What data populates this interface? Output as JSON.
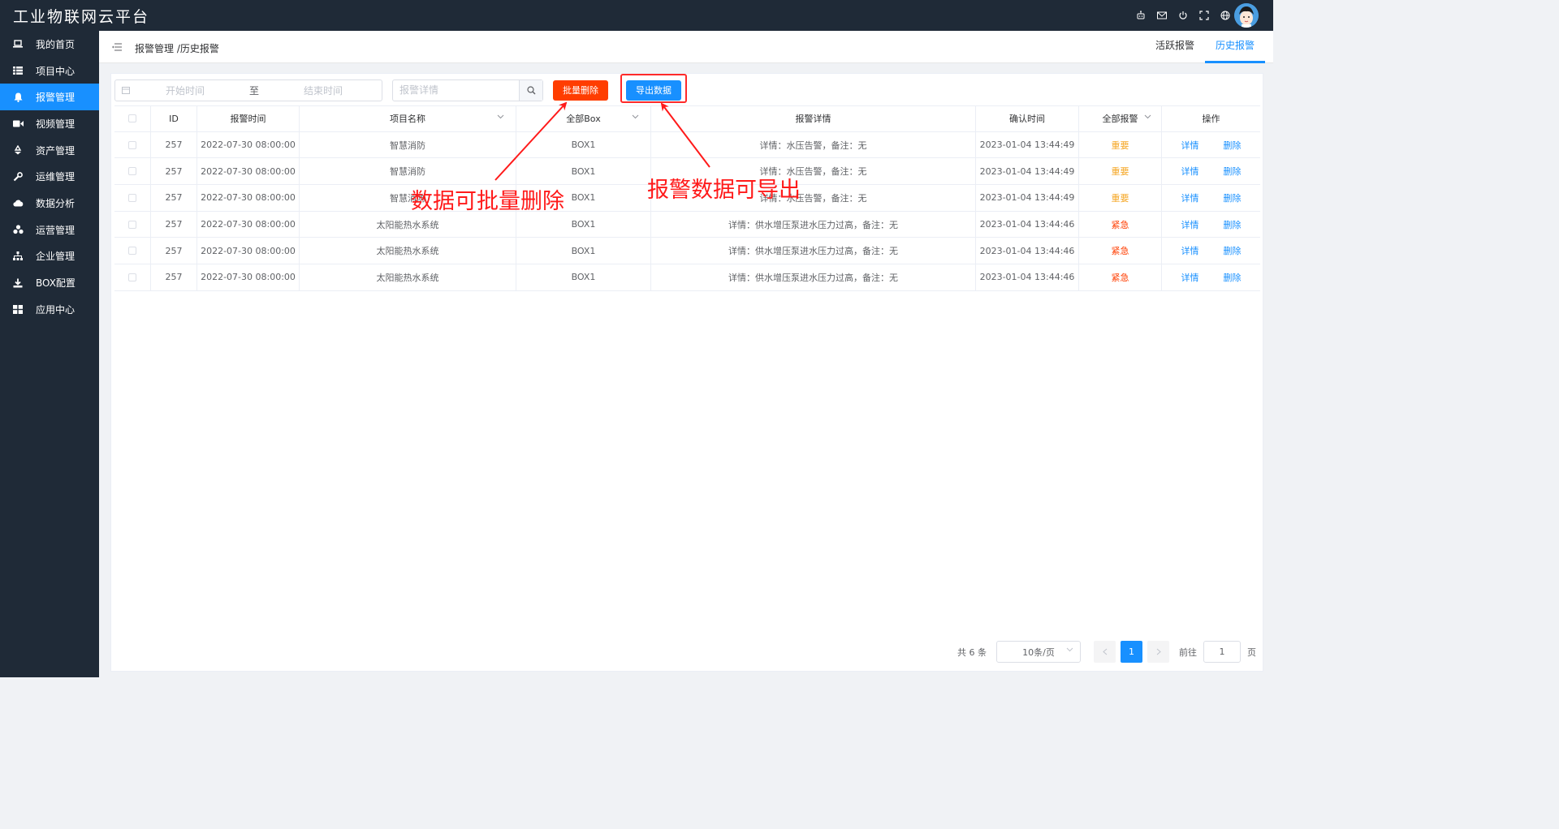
{
  "app": {
    "title": "工业物联网云平台"
  },
  "colors": {
    "sidebar_bg": "#1f2a37",
    "accent": "#1890ff",
    "danger": "#ff3d00",
    "warning": "#f5a623"
  },
  "topbar": {
    "icons": [
      "robot-icon",
      "mail-icon",
      "power-icon",
      "fullscreen-icon",
      "globe-icon"
    ]
  },
  "sidebar": {
    "items": [
      {
        "label": "我的首页",
        "icon": "laptop-icon",
        "active": false
      },
      {
        "label": "项目中心",
        "icon": "list-icon",
        "active": false
      },
      {
        "label": "报警管理",
        "icon": "bell-icon",
        "active": true
      },
      {
        "label": "视频管理",
        "icon": "video-icon",
        "active": false
      },
      {
        "label": "资产管理",
        "icon": "recycle-icon",
        "active": false
      },
      {
        "label": "运维管理",
        "icon": "wrench-icon",
        "active": false
      },
      {
        "label": "数据分析",
        "icon": "cloud-icon",
        "active": false
      },
      {
        "label": "运营管理",
        "icon": "cubes-icon",
        "active": false
      },
      {
        "label": "企业管理",
        "icon": "sitemap-icon",
        "active": false
      },
      {
        "label": "BOX配置",
        "icon": "download-icon",
        "active": false
      },
      {
        "label": "应用中心",
        "icon": "grid-icon",
        "active": false
      }
    ]
  },
  "header": {
    "breadcrumb": "报警管理 /历史报警",
    "tabs": [
      {
        "label": "活跃报警",
        "active": false
      },
      {
        "label": "历史报警",
        "active": true
      }
    ]
  },
  "filter": {
    "start_placeholder": "开始时间",
    "range_sep": "至",
    "end_placeholder": "结束时间",
    "search_placeholder": "报警详情",
    "batch_delete_label": "批量删除",
    "export_label": "导出数据"
  },
  "table": {
    "headers": {
      "id": "ID",
      "alarm_time": "报警时间",
      "project": "项目名称",
      "box": "全部Box",
      "detail": "报警详情",
      "confirm_time": "确认时间",
      "level": "全部报警",
      "ops": "操作"
    },
    "rows": [
      {
        "id": "257",
        "alarm_time": "2022-07-30 08:00:00",
        "project": "智慧消防",
        "box": "BOX1",
        "detail": "详情：水压告警，备注：无",
        "confirm_time": "2023-01-04 13:44:49",
        "level": "重要",
        "level_type": "important",
        "op_detail": "详情",
        "op_delete": "删除"
      },
      {
        "id": "257",
        "alarm_time": "2022-07-30 08:00:00",
        "project": "智慧消防",
        "box": "BOX1",
        "detail": "详情：水压告警，备注：无",
        "confirm_time": "2023-01-04 13:44:49",
        "level": "重要",
        "level_type": "important",
        "op_detail": "详情",
        "op_delete": "删除"
      },
      {
        "id": "257",
        "alarm_time": "2022-07-30 08:00:00",
        "project": "智慧消防",
        "box": "BOX1",
        "detail": "详情：水压告警，备注：无",
        "confirm_time": "2023-01-04 13:44:49",
        "level": "重要",
        "level_type": "important",
        "op_detail": "详情",
        "op_delete": "删除"
      },
      {
        "id": "257",
        "alarm_time": "2022-07-30 08:00:00",
        "project": "太阳能热水系统",
        "box": "BOX1",
        "detail": "详情：供水增压泵进水压力过高，备注：无",
        "confirm_time": "2023-01-04 13:44:46",
        "level": "紧急",
        "level_type": "urgent",
        "op_detail": "详情",
        "op_delete": "删除"
      },
      {
        "id": "257",
        "alarm_time": "2022-07-30 08:00:00",
        "project": "太阳能热水系统",
        "box": "BOX1",
        "detail": "详情：供水增压泵进水压力过高，备注：无",
        "confirm_time": "2023-01-04 13:44:46",
        "level": "紧急",
        "level_type": "urgent",
        "op_detail": "详情",
        "op_delete": "删除"
      },
      {
        "id": "257",
        "alarm_time": "2022-07-30 08:00:00",
        "project": "太阳能热水系统",
        "box": "BOX1",
        "detail": "详情：供水增压泵进水压力过高，备注：无",
        "confirm_time": "2023-01-04 13:44:46",
        "level": "紧急",
        "level_type": "urgent",
        "op_detail": "详情",
        "op_delete": "删除"
      }
    ]
  },
  "pagination": {
    "total_text": "共 6 条",
    "page_size": "10条/页",
    "current_page": "1",
    "goto_label": "前往",
    "goto_value": "1",
    "page_suffix": "页"
  },
  "annotations": {
    "batch_delete_note": "数据可批量删除",
    "export_note": "报警数据可导出"
  }
}
